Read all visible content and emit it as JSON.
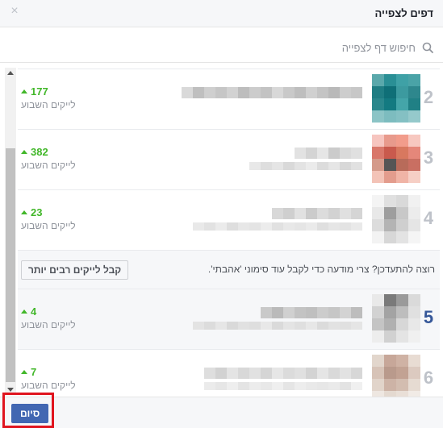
{
  "header": {
    "title": "דפים לצפייה",
    "close_glyph": "×"
  },
  "search": {
    "placeholder": "חיפוש דף לצפייה",
    "value": "",
    "icon": "search-icon"
  },
  "rows": [
    {
      "rank": "2",
      "count": "177",
      "label": "לייקים השבוע",
      "thumb_colors": [
        "#5aa8ab",
        "#2a8f95",
        "#3fa1a6",
        "#4aa3a7",
        "#1f7d83",
        "#0f6f77",
        "#3c9a9f",
        "#2e878d",
        "#2a878c",
        "#137a81",
        "#44a5a9",
        "#208085",
        "#8cc4c6",
        "#7dbcbf",
        "#84c0c3",
        "#95c9cb"
      ],
      "blur_colors": [
        "#d9d9d9",
        "#bfbfbf",
        "#cfcfcf",
        "#c6c6c6",
        "#d2d2d2",
        "#bdbdbd",
        "#cccccc",
        "#c3c3c3",
        "#d8d8d8",
        "#c9c9c9",
        "#bebebe",
        "#d0d0d0",
        "#c4c4c4",
        "#b9b9b9",
        "#cdcdcd",
        "#c7c7c7"
      ],
      "blur2_colors": []
    },
    {
      "rank": "3",
      "count": "382",
      "label": "לייקים השבוע",
      "thumb_colors": [
        "#f6c5bf",
        "#e89a8c",
        "#f29c8b",
        "#f7c8c0",
        "#d9776a",
        "#c95a4d",
        "#d8785f",
        "#e5877a",
        "#d49a8a",
        "#555555",
        "#b86b5a",
        "#c96f62",
        "#f3c3b7",
        "#e39c8d",
        "#f0b4a6",
        "#f6cfc5"
      ],
      "blur_colors": [
        "#e2e2e2",
        "#d4d4d4",
        "#e6e6e6",
        "#cbcbcb",
        "#dadada",
        "#e0e0e0"
      ],
      "blur2_colors": [
        "#e8e8e8",
        "#dedede",
        "#e5e5e5",
        "#d9d9d9",
        "#e3e3e3",
        "#ebebeb",
        "#dcdcdc",
        "#e6e6e6",
        "#d8d8d8",
        "#e1e1e1"
      ]
    },
    {
      "rank": "4",
      "count": "23",
      "label": "לייקים השבוע",
      "thumb_colors": [
        "#f4f4f4",
        "#e0e0e0",
        "#d9d9d9",
        "#f1f1f1",
        "#e8e8e8",
        "#9e9e9e",
        "#c8c8c8",
        "#ececec",
        "#dcdcdc",
        "#b4b4b4",
        "#cfcfcf",
        "#e5e5e5",
        "#f3f3f3",
        "#d7d7d7",
        "#e3e3e3",
        "#f5f5f5"
      ],
      "blur_colors": [
        "#d8d8d8",
        "#cfcfcf",
        "#e1e1e1",
        "#cbcbcb",
        "#dcdcdc",
        "#d2d2d2",
        "#e0e0e0",
        "#d5d5d5"
      ],
      "blur2_colors": [
        "#e9e9e9",
        "#e2e2e2",
        "#ebebeb",
        "#dedede",
        "#e7e7e7",
        "#e4e4e4",
        "#ececec",
        "#e1e1e1",
        "#e8e8e8",
        "#e5e5e5",
        "#eaeaea",
        "#dfdfdf",
        "#e6e6e6",
        "#e3e3e3",
        "#e9e9e9"
      ]
    },
    {
      "rank": "5",
      "count": "4",
      "label": "לייקים השבוע",
      "thumb_colors": [
        "#e9e9e9",
        "#7a7a7a",
        "#9a9a9a",
        "#dadada",
        "#d2d2d2",
        "#a3a3a3",
        "#bdbdbd",
        "#e0e0e0",
        "#c4c4c4",
        "#b0b0b0",
        "#d7d7d7",
        "#e8e8e8",
        "#ededed",
        "#d1d1d1",
        "#e4e4e4",
        "#f0f0f0"
      ],
      "blur_colors": [
        "#c9c9c9",
        "#bababa",
        "#d0d0d0",
        "#c3c3c3",
        "#bfbfbf",
        "#cccccc",
        "#c6c6c6",
        "#d3d3d3",
        "#bdbdbd"
      ],
      "blur2_colors": [
        "#e3e3e3",
        "#dcdcdc",
        "#e6e6e6",
        "#d9d9d9",
        "#e1e1e1",
        "#dedede",
        "#e8e8e8",
        "#dadada",
        "#e4e4e4",
        "#dfdfdf",
        "#e7e7e7",
        "#dbdbdb",
        "#e2e2e2",
        "#e0e0e0",
        "#e5e5e5"
      ]
    },
    {
      "rank": "6",
      "count": "7",
      "label": "לייקים השבוע",
      "thumb_colors": [
        "#e2d6cc",
        "#c7a799",
        "#cfb2a4",
        "#e8dcd3",
        "#d7c3b7",
        "#b99a8c",
        "#c2a293",
        "#dccac0",
        "#e1d4ca",
        "#cdb3a6",
        "#d3bdb0",
        "#e6dbd2",
        "#eee7e1",
        "#e4d9d0",
        "#e9dfd7",
        "#f1ebe6"
      ],
      "blur_colors": [
        "#dedede",
        "#d2d2d2",
        "#e4e4e4",
        "#d8d8d8",
        "#e1e1e1",
        "#d5d5d5",
        "#e6e6e6",
        "#dbdbdb",
        "#e0e0e0",
        "#d3d3d3",
        "#e5e5e5",
        "#d9d9d9",
        "#e2e2e2",
        "#d7d7d7"
      ],
      "blur2_colors": [
        "#ebebeb",
        "#e6e6e6",
        "#eeeeee",
        "#e4e4e4",
        "#ececec",
        "#e8e8e8",
        "#efefef",
        "#e5e5e5",
        "#ededed",
        "#e9e9e9",
        "#e7e7e7",
        "#eaeaea",
        "#e3e3e3",
        "#f0f0f0"
      ]
    }
  ],
  "promo": {
    "text": "רוצה להתעדכן? צרי מודעה כדי לקבל עוד סימוני 'אהבתי'.",
    "button_label": "קבל לייקים רבים יותר"
  },
  "footer": {
    "done_label": "סיום",
    "highlight_color": "#e0141e"
  },
  "colors": {
    "accent": "#4267b2",
    "positive": "#42b72a",
    "muted": "#90949c"
  }
}
